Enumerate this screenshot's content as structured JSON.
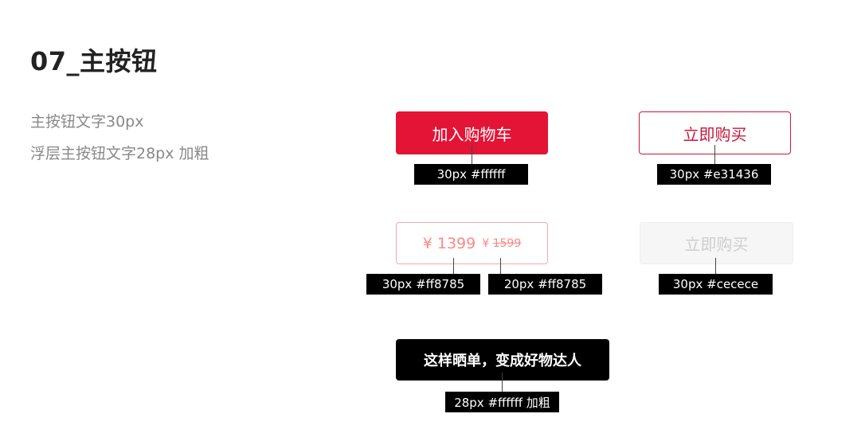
{
  "title": "07_主按钮",
  "descriptions": {
    "line1": "主按钮文字30px",
    "line2": "浮层主按钮文字28px 加粗"
  },
  "buttons": {
    "add_to_cart": {
      "label": "加入购物车",
      "spec": "30px  #ffffff"
    },
    "buy_now": {
      "label": "立即购买",
      "spec": "30px  #e31436"
    },
    "price": {
      "currency": "¥",
      "price": "1399",
      "currency_old": "¥",
      "old_price": "1599",
      "spec_main": "30px  #ff8785",
      "spec_sub": "20px  #ff8785"
    },
    "buy_now_disabled": {
      "label": "立即购买",
      "spec": "30px  #cecece"
    },
    "share": {
      "label": "这样晒单，变成好物达人",
      "spec": "28px  #ffffff  加粗"
    }
  },
  "colors": {
    "primary": "#e31436",
    "outline": "#c8173e",
    "price": "#ff8785",
    "disabled": "#cecece",
    "black": "#000000",
    "white": "#ffffff"
  }
}
